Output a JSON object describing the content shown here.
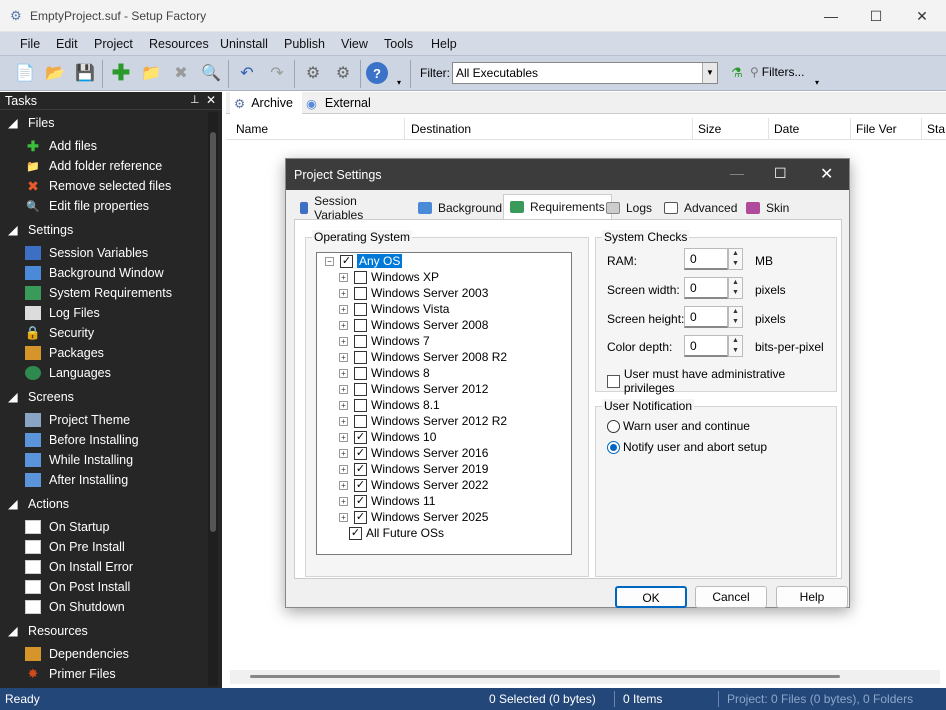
{
  "window": {
    "title": "EmptyProject.suf - Setup Factory",
    "min": "—",
    "max": "☐",
    "close": "✕"
  },
  "menu": [
    "File",
    "Edit",
    "Project",
    "Resources",
    "Uninstall",
    "Publish",
    "View",
    "Tools",
    "Help"
  ],
  "toolbar": {
    "filter_label": "Filter:",
    "filter_value": "All Executables",
    "filters_button": "Filters..."
  },
  "tasks": {
    "title": "Tasks",
    "sections": [
      {
        "name": "Files",
        "items": [
          "Add files",
          "Add folder reference",
          "Remove selected files",
          "Edit file properties"
        ]
      },
      {
        "name": "Settings",
        "items": [
          "Session Variables",
          "Background Window",
          "System Requirements",
          "Log Files",
          "Security",
          "Packages",
          "Languages"
        ]
      },
      {
        "name": "Screens",
        "items": [
          "Project Theme",
          "Before Installing",
          "While Installing",
          "After Installing"
        ]
      },
      {
        "name": "Actions",
        "items": [
          "On Startup",
          "On Pre Install",
          "On Install Error",
          "On Post Install",
          "On Shutdown"
        ]
      },
      {
        "name": "Resources",
        "items": [
          "Dependencies",
          "Primer Files"
        ]
      }
    ]
  },
  "main": {
    "tabs": [
      "Archive",
      "External"
    ],
    "columns": [
      "Name",
      "Destination",
      "Size",
      "Date",
      "File Ver",
      "Sta"
    ]
  },
  "status": {
    "ready": "Ready",
    "selected": "0 Selected (0 bytes)",
    "items": "0 Items",
    "project": "Project: 0 Files (0 bytes), 0 Folders"
  },
  "dialog": {
    "title": "Project Settings",
    "tabs": [
      "Session Variables",
      "Background",
      "Requirements",
      "Logs",
      "Advanced",
      "Skin"
    ],
    "os_group": "Operating System",
    "os_root": "Any OS",
    "os_items": [
      {
        "name": "Windows XP",
        "checked": false
      },
      {
        "name": "Windows Server 2003",
        "checked": false
      },
      {
        "name": "Windows Vista",
        "checked": false
      },
      {
        "name": "Windows Server 2008",
        "checked": false
      },
      {
        "name": "Windows 7",
        "checked": false
      },
      {
        "name": "Windows Server 2008 R2",
        "checked": false
      },
      {
        "name": "Windows 8",
        "checked": false
      },
      {
        "name": "Windows Server 2012",
        "checked": false
      },
      {
        "name": "Windows 8.1",
        "checked": false
      },
      {
        "name": "Windows Server 2012 R2",
        "checked": false
      },
      {
        "name": "Windows 10",
        "checked": true
      },
      {
        "name": "Windows Server 2016",
        "checked": true
      },
      {
        "name": "Windows Server 2019",
        "checked": true
      },
      {
        "name": "Windows Server 2022",
        "checked": true
      },
      {
        "name": "Windows 11",
        "checked": true
      },
      {
        "name": "Windows Server 2025",
        "checked": true
      }
    ],
    "future": "All Future OSs",
    "checks_group": "System Checks",
    "ram_label": "RAM:",
    "ram_value": "0",
    "ram_unit": "MB",
    "sw_label": "Screen width:",
    "sw_value": "0",
    "sw_unit": "pixels",
    "sh_label": "Screen height:",
    "sh_value": "0",
    "sh_unit": "pixels",
    "cd_label": "Color depth:",
    "cd_value": "0",
    "cd_unit": "bits-per-pixel",
    "admin_label": "User must have administrative privileges",
    "notify_group": "User Notification",
    "warn_label": "Warn user and continue",
    "abort_label": "Notify user and abort setup",
    "ok": "OK",
    "cancel": "Cancel",
    "help": "Help"
  }
}
